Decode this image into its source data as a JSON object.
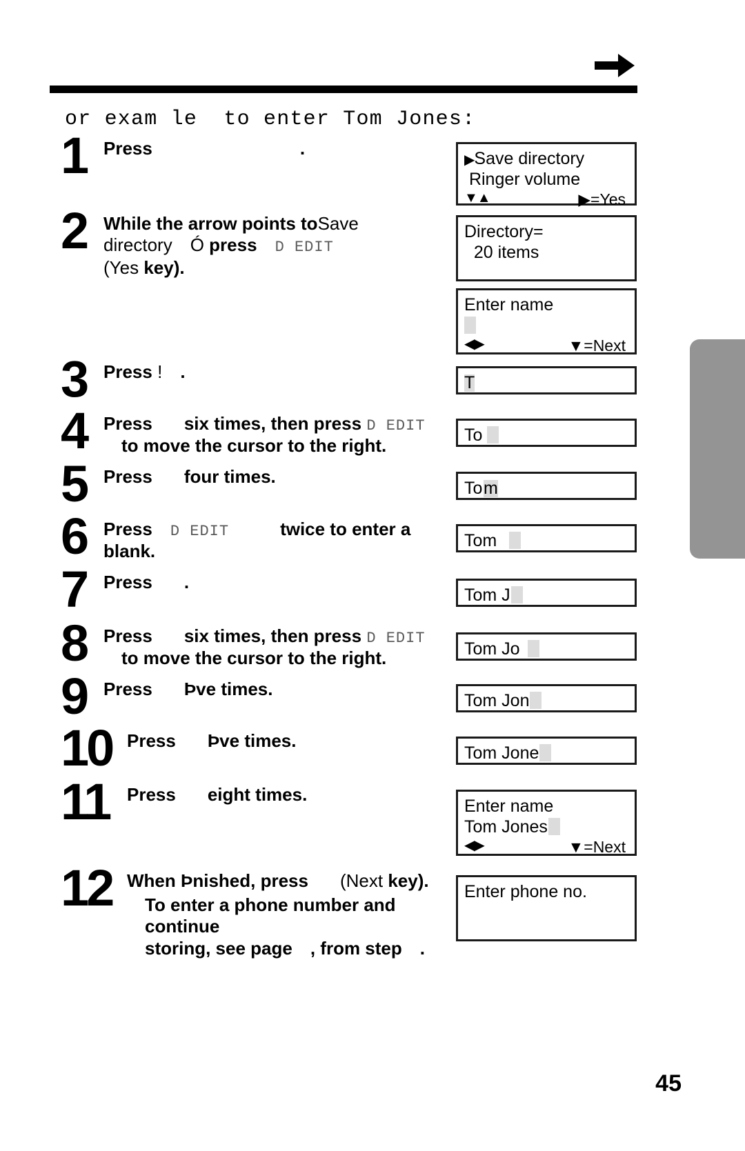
{
  "header": {
    "arrow_icon": "right-arrow-icon",
    "rule": "horizontal-rule"
  },
  "intro": "or exam le  to enter Tom Jones:",
  "page_number": "45",
  "keycap_edit": "D EDIT",
  "steps": [
    {
      "number": "1",
      "text_before": "Press",
      "text_after": "."
    },
    {
      "number": "2",
      "line1_bold": "While the arrow points to",
      "line1_reg": "Save",
      "line2_reg_a": "directory",
      "line2_mark": "Ó",
      "line2_bold": "press",
      "line2_key": "D EDIT",
      "line3_paren_open": "(",
      "line3_reg": "Yes",
      "line3_bold": "key)."
    },
    {
      "number": "3",
      "text_before": "Press",
      "text_mark": "!",
      "text_after": "."
    },
    {
      "number": "4",
      "line1_a": "Press",
      "line1_b": "six times, then press",
      "line1_key": "D EDIT",
      "line2": "to move the cursor to the right."
    },
    {
      "number": "5",
      "line1_a": "Press",
      "line1_b": "four times."
    },
    {
      "number": "6",
      "line1_a": "Press",
      "line1_key": "D EDIT",
      "line1_b": "twice to enter a blank."
    },
    {
      "number": "7",
      "line1_a": "Press",
      "line1_b": "."
    },
    {
      "number": "8",
      "line1_a": "Press",
      "line1_b": "six times, then press",
      "line1_key": "D EDIT",
      "line2": "to move the cursor to the right."
    },
    {
      "number": "9",
      "line1_a": "Press",
      "line1_b": "Þve times."
    },
    {
      "number": "10",
      "line1_a": "Press",
      "line1_b": "Þve times."
    },
    {
      "number": "11",
      "line1_a": "Press",
      "line1_b": "eight times."
    },
    {
      "number": "12",
      "line1_a": "When",
      "line1_b": "Þnished, press",
      "line1_paren_open": "(",
      "line1_reg": "Next",
      "line1_bold": "key).",
      "line2": "To enter a phone number and continue",
      "line3_a": "storing, see page",
      "line3_b": ", from step",
      "line3_c": "."
    }
  ],
  "displays": [
    {
      "id": "display-menu",
      "rows": [
        {
          "arrow": "▶",
          "text": "Save directory"
        },
        {
          "arrow": "",
          "text": " Ringer volume"
        }
      ],
      "hint_left": "▼▲",
      "hint_right": "▶=Yes"
    },
    {
      "id": "display-directory-count",
      "rows": [
        {
          "text": "Directory="
        },
        {
          "text": "  20 items"
        }
      ]
    },
    {
      "id": "display-enter-name-empty",
      "rows": [
        {
          "text": "Enter name"
        },
        {
          "text": "",
          "cursor": true
        }
      ],
      "hint_left": "◀▶",
      "hint_right": "▼=Next"
    },
    {
      "id": "display-t",
      "text": "T",
      "cursor_mode": "over-last"
    },
    {
      "id": "display-to",
      "text": "To",
      "cursor_mode": "after-gap"
    },
    {
      "id": "display-tom-1",
      "text": "Tom",
      "cursor_mode": "over-last"
    },
    {
      "id": "display-tom-blank",
      "text": "Tom",
      "cursor_mode": "after-gap"
    },
    {
      "id": "display-tom-j",
      "text": "Tom J",
      "cursor_mode": "over-last"
    },
    {
      "id": "display-tom-jo",
      "text": "Tom Jo",
      "cursor_mode": "after-gap"
    },
    {
      "id": "display-tom-jon",
      "text": "Tom Jon",
      "cursor_mode": "over-last"
    },
    {
      "id": "display-tom-jone",
      "text": "Tom Jone",
      "cursor_mode": "over-last"
    },
    {
      "id": "display-enter-name-full",
      "rows": [
        {
          "text": "Enter name"
        },
        {
          "text": "Tom Jones",
          "cursor": true
        }
      ],
      "hint_left": "◀▶",
      "hint_right": "▼=Next"
    },
    {
      "id": "display-enter-phone",
      "rows": [
        {
          "text": "Enter phone no."
        }
      ]
    }
  ]
}
